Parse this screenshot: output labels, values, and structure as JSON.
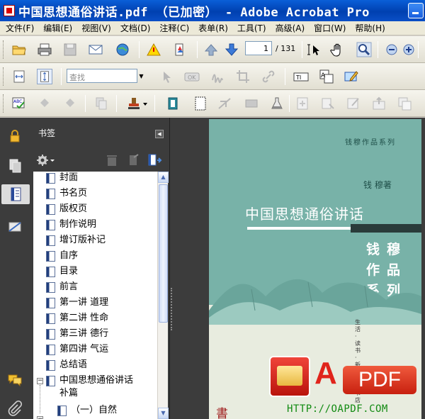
{
  "window": {
    "title": "中国思想通俗讲话.pdf （已加密） - Adobe Acrobat Pro"
  },
  "menu": [
    "文件(F)",
    "编辑(E)",
    "视图(V)",
    "文档(D)",
    "注释(C)",
    "表单(R)",
    "工具(T)",
    "高级(A)",
    "窗口(W)",
    "帮助(H)"
  ],
  "navigation": {
    "current_page": "1",
    "total_pages": "/ 131"
  },
  "find": {
    "placeholder": "查找"
  },
  "bookmarks_panel": {
    "title": "书签",
    "items": [
      {
        "label": "封面"
      },
      {
        "label": "书名页"
      },
      {
        "label": "版权页"
      },
      {
        "label": "制作说明"
      },
      {
        "label": "增订版补记"
      },
      {
        "label": "自序"
      },
      {
        "label": "目录"
      },
      {
        "label": "前言"
      },
      {
        "label": "第一讲 道理"
      },
      {
        "label": "第二讲 性命"
      },
      {
        "label": "第三讲 德行"
      },
      {
        "label": "第四讲 气运"
      },
      {
        "label": "总结语"
      },
      {
        "label_line1": "中国思想通俗讲话",
        "label_line2": "补篇"
      },
      {
        "label": "（一）自然"
      }
    ]
  },
  "page_content": {
    "series_top": "钱穆作品系列",
    "author": "钱 穆著",
    "book_title": "中国思想通俗讲话",
    "series_vertical": "钱穆作品系列",
    "publisher_vertical": "生活·读书·新知三联书店",
    "seal_char": "書"
  },
  "watermark": {
    "letter": "A",
    "pdf": "PDF",
    "url": "HTTP://OAPDF.COM"
  },
  "colors": {
    "titlebar": "#0040b0",
    "cover_green": "#78b2a8",
    "panel_dark": "#3c3c3c"
  }
}
